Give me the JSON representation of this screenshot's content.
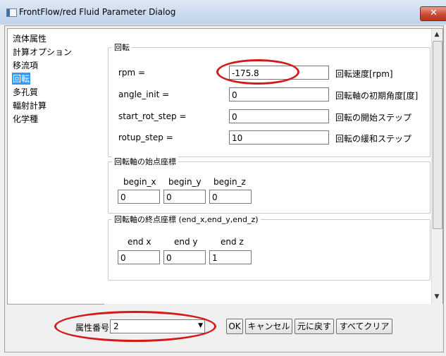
{
  "window": {
    "title": "FrontFlow/red Fluid Parameter Dialog",
    "close_glyph": "✕"
  },
  "sidebar": {
    "items": [
      {
        "label": "流体属性"
      },
      {
        "label": "計算オプション"
      },
      {
        "label": "移流項"
      },
      {
        "label": "回転",
        "selected": true
      },
      {
        "label": "多孔質"
      },
      {
        "label": "輻射計算"
      },
      {
        "label": "化学種"
      }
    ]
  },
  "rotation": {
    "group_label": "回転",
    "rows": [
      {
        "label": "rpm =",
        "value": "-175.8",
        "desc": "回転速度[rpm]"
      },
      {
        "label": "angle_init =",
        "value": "0",
        "desc": "回転軸の初期角度[度]"
      },
      {
        "label": "start_rot_step =",
        "value": "0",
        "desc": "回転の開始ステップ"
      },
      {
        "label": "rotup_step =",
        "value": "10",
        "desc": "回転の緩和ステップ"
      }
    ]
  },
  "begin_axis": {
    "group_label": "回転軸の始点座標",
    "headers": [
      "begin_x",
      "begin_y",
      "begin_z"
    ],
    "values": [
      "0",
      "0",
      "0"
    ]
  },
  "end_axis": {
    "group_label": "回転軸の終点座標 (end_x,end_y,end_z)",
    "headers": [
      "end x",
      "end y",
      "end z"
    ],
    "values": [
      "0",
      "0",
      "1"
    ]
  },
  "footer": {
    "attr_label": "属性番号",
    "attr_value": "2",
    "buttons": {
      "ok": "OK",
      "cancel": "キャンセル",
      "revert": "元に戻す",
      "clear": "すべてクリア"
    }
  },
  "colors": {
    "highlight_oval": "#d21a1a",
    "selection": "#3399ff"
  }
}
